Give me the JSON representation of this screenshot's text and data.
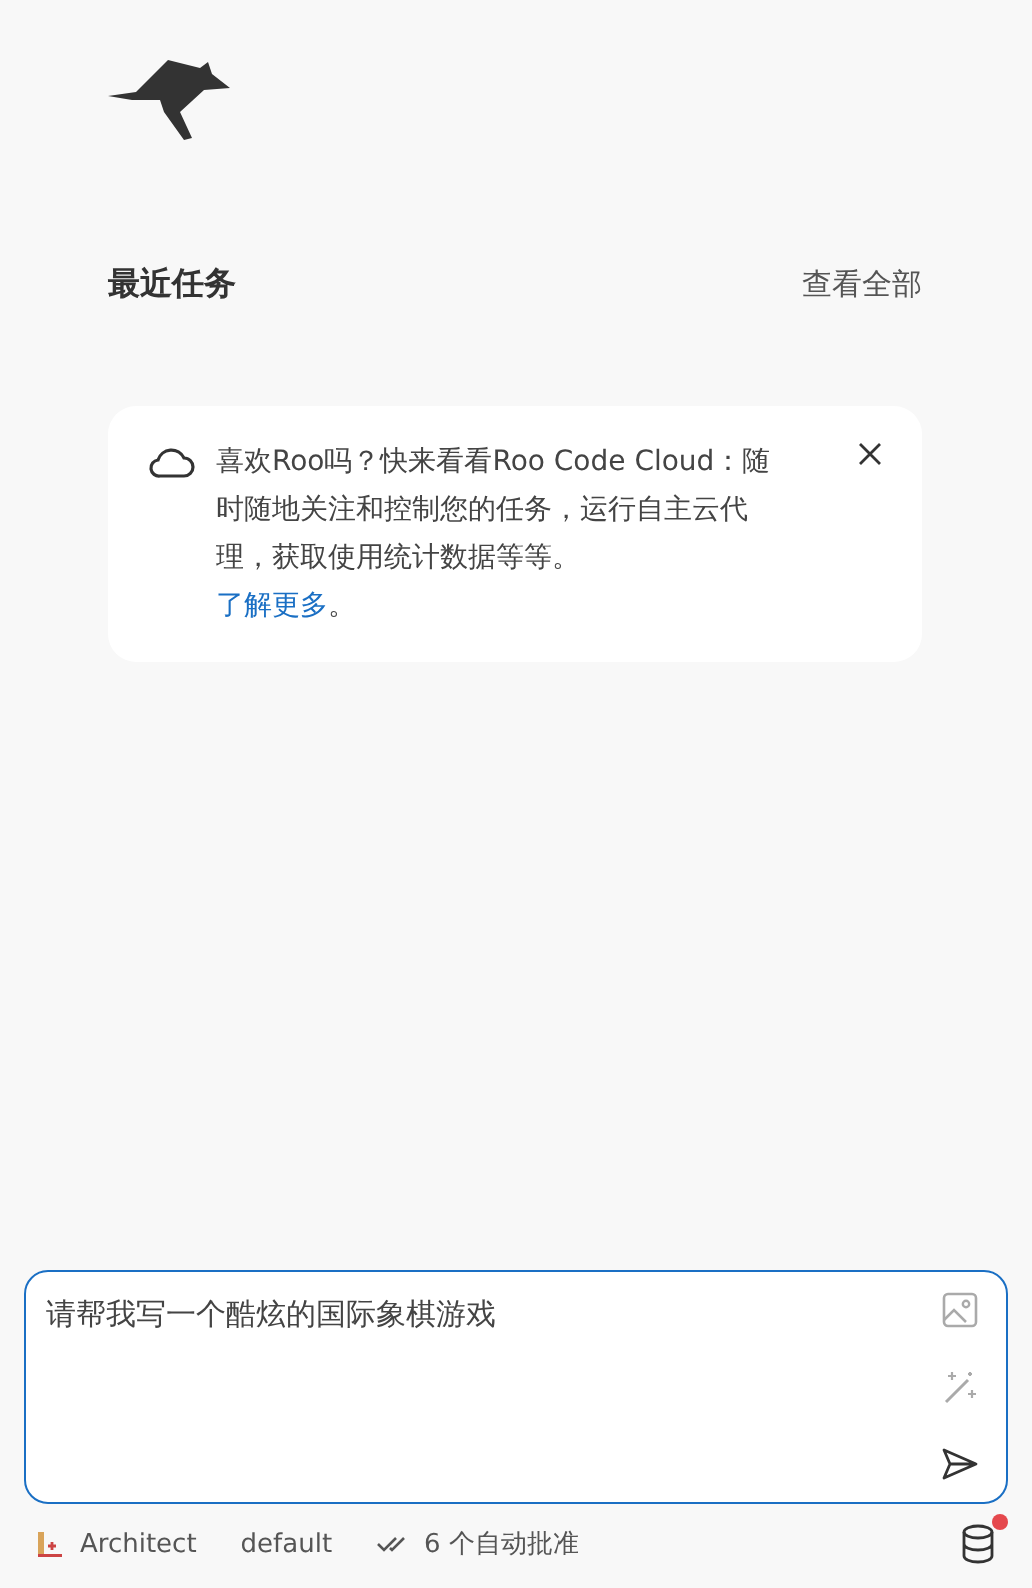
{
  "recent_tasks": {
    "title": "最近任务",
    "view_all": "查看全部"
  },
  "cloud_notice": {
    "message": "喜欢Roo吗？快来看看Roo Code Cloud：随时随地关注和控制您的任务，运行自主云代理，获取使用统计数据等等。",
    "link": "了解更多",
    "link_suffix": "。"
  },
  "chat_input": {
    "value": "请帮我写一个酷炫的国际象棋游戏"
  },
  "footer": {
    "mode": "Architect",
    "config": "default",
    "auto_approve": "6 个自动批准",
    "notification": true
  }
}
